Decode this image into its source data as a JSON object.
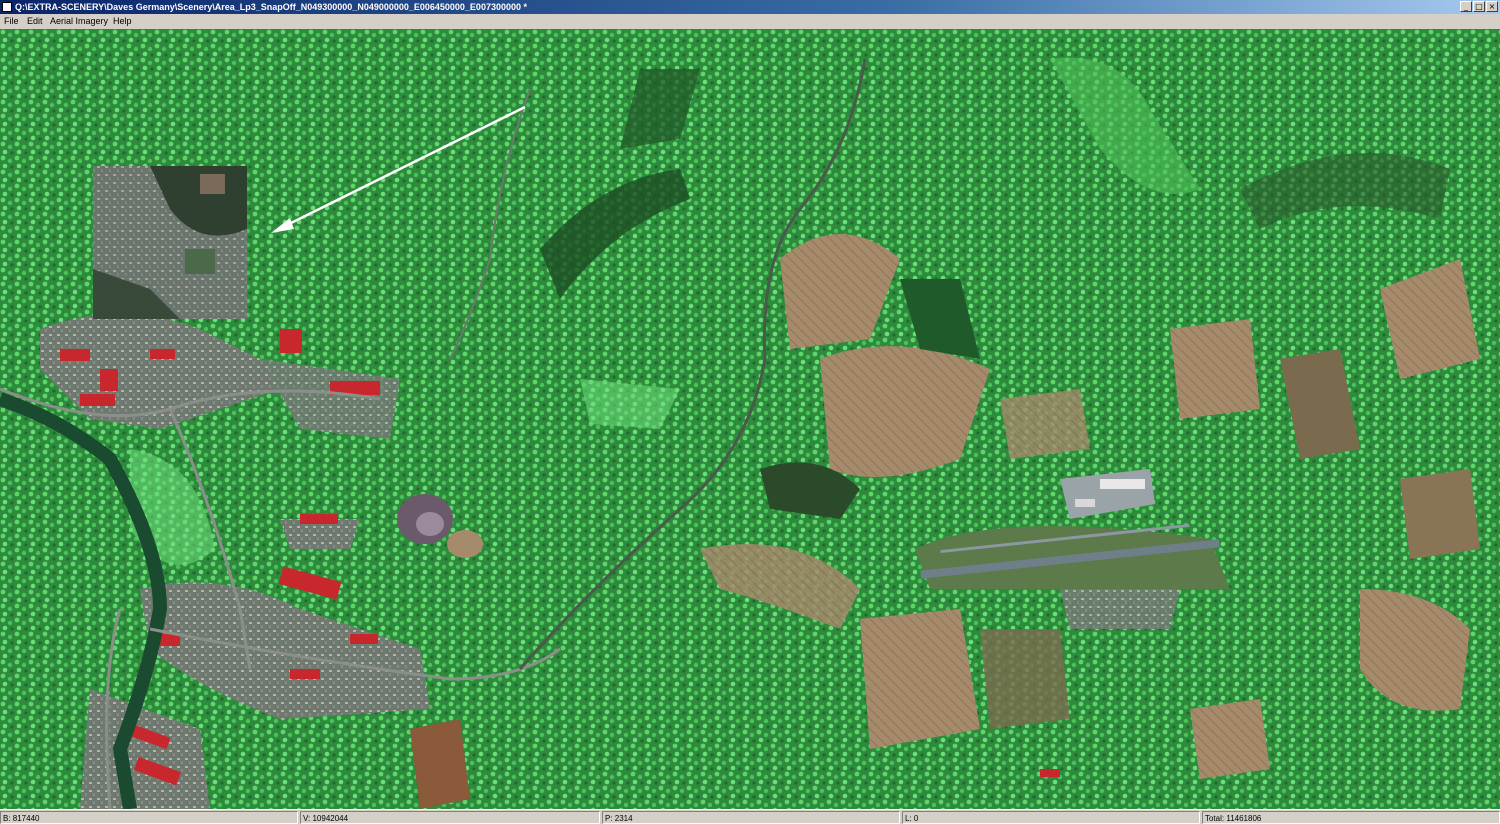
{
  "window": {
    "title": "Q:\\EXTRA-SCENERY\\Daves Germany\\Scenery\\Area_Lp3_SnapOff_N049300000_N049000000_E006450000_E007300000 *",
    "minimize_glyph": "_",
    "maximize_glyph": "□",
    "close_glyph": "×"
  },
  "menu": {
    "items": [
      "File",
      "Edit",
      "Aerial Imagery",
      "Help"
    ]
  },
  "map": {
    "content": "aerial imagery with vegetation overlay",
    "overlay_color": "#33b34a",
    "accent_colors": {
      "roofs": "#c8282d",
      "runway": "#6f7f8a",
      "fields": "#a88a6a"
    },
    "annotation": "white arrow pointing to inset image"
  },
  "status": {
    "b": "B: 817440",
    "v": "V: 10942044",
    "p": "P: 2314",
    "l": "L: 0",
    "total": "Total: 11461806"
  }
}
